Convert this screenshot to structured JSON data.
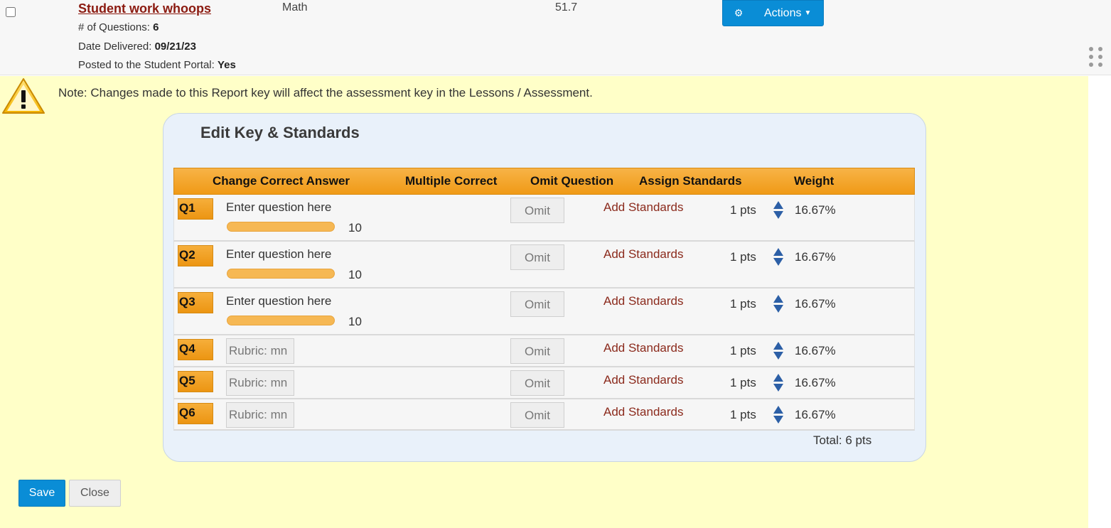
{
  "assessment": {
    "title": "Student work whoops",
    "questions_label": "# of Questions: ",
    "questions_value": "6",
    "delivered_label": "Date Delivered: ",
    "delivered_value": "09/21/23",
    "posted_label": "Posted to the Student Portal: ",
    "posted_value": "Yes",
    "subject": "Math",
    "score": "51.7",
    "actions_label": "Actions",
    "checkbox_checked": false
  },
  "note": {
    "text": "Note: Changes made to this Report key will affect the assessment key in the Lessons / Assessment.",
    "icon": "warning-icon"
  },
  "editor": {
    "title": "Edit Key & Standards",
    "headers": {
      "change": "Change Correct Answer",
      "multiple": "Multiple Correct",
      "omit": "Omit Question",
      "standards": "Assign Standards",
      "weight": "Weight"
    },
    "questions": [
      {
        "label": "Q1",
        "text": "Enter question here",
        "slider_value": "10",
        "omit": "Omit",
        "standards": "Add Standards",
        "points": "1 pts",
        "weight": "16.67%"
      },
      {
        "label": "Q2",
        "text": "Enter question here",
        "slider_value": "10",
        "omit": "Omit",
        "standards": "Add Standards",
        "points": "1 pts",
        "weight": "16.67%"
      },
      {
        "label": "Q3",
        "text": "Enter question here",
        "slider_value": "10",
        "omit": "Omit",
        "standards": "Add Standards",
        "points": "1 pts",
        "weight": "16.67%"
      },
      {
        "label": "Q4",
        "rubric": "Rubric: mn",
        "omit": "Omit",
        "standards": "Add Standards",
        "points": "1 pts",
        "weight": "16.67%"
      },
      {
        "label": "Q5",
        "rubric": "Rubric: mn",
        "omit": "Omit",
        "standards": "Add Standards",
        "points": "1 pts",
        "weight": "16.67%"
      },
      {
        "label": "Q6",
        "rubric": "Rubric: mn",
        "omit": "Omit",
        "standards": "Add Standards",
        "points": "1 pts",
        "weight": "16.67%"
      }
    ],
    "total": "Total: 6 pts"
  },
  "buttons": {
    "save": "Save",
    "close": "Close"
  },
  "colors": {
    "accent_blue": "#0a8dd6",
    "header_orange": "#f09a16",
    "note_yellow": "#ffffc8",
    "link_red": "#8b2a1c"
  }
}
